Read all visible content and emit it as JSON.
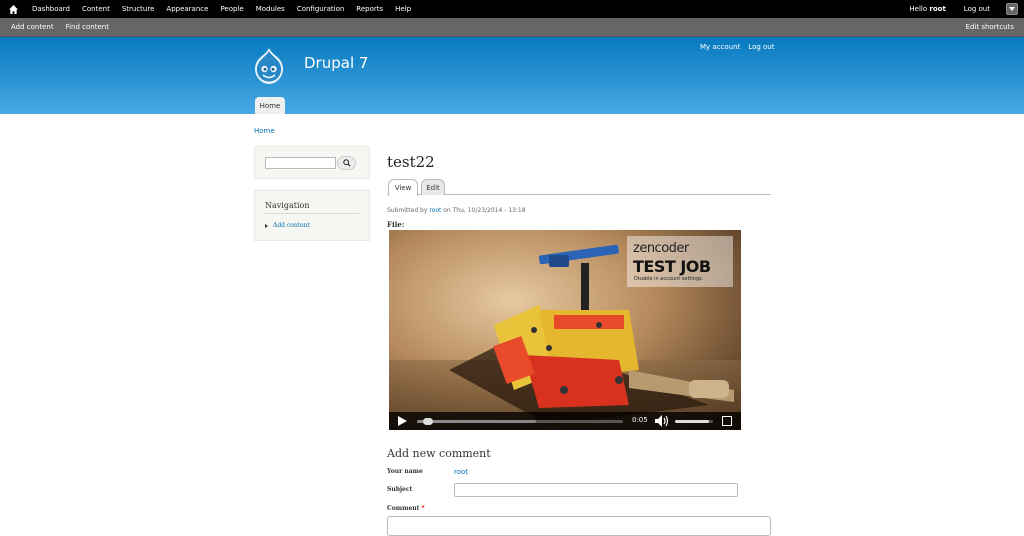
{
  "toolbar": {
    "menu": [
      "Dashboard",
      "Content",
      "Structure",
      "Appearance",
      "People",
      "Modules",
      "Configuration",
      "Reports",
      "Help"
    ],
    "hello_prefix": "Hello ",
    "user": "root",
    "logout": "Log out",
    "shortcuts": [
      "Add content",
      "Find content"
    ],
    "edit_shortcuts": "Edit shortcuts"
  },
  "header": {
    "site_name": "Drupal 7",
    "secondary_menu": [
      "My account",
      "Log out"
    ],
    "main_tab": "Home"
  },
  "breadcrumb": "Home",
  "sidebar": {
    "search_placeholder": "",
    "navigation_title": "Navigation",
    "navigation_items": [
      "Add content"
    ]
  },
  "node": {
    "title": "test22",
    "tabs": [
      "View",
      "Edit"
    ],
    "submitted_prefix": "Submitted by ",
    "submitted_user": "root",
    "submitted_suffix": " on Thu, 10/23/2014 - 13:18",
    "file_label": "File:"
  },
  "video": {
    "badge_brand": "zencoder",
    "badge_title": "TEST JOB",
    "badge_note": "Disable in account settings.",
    "time": "0:05",
    "progress": 0.03,
    "buffered": 0.58,
    "volume": 0.9
  },
  "comment_form": {
    "title": "Add new comment",
    "name_label": "Your name",
    "name_value": "root",
    "subject_label": "Subject",
    "comment_label": "Comment",
    "required_mark": "*"
  },
  "colors": {
    "header_top": "#0779bf",
    "header_bottom": "#48a9e4",
    "link": "#0071b3"
  }
}
